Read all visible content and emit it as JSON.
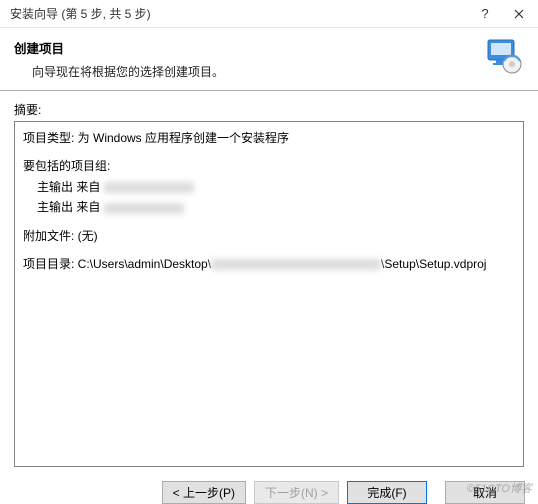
{
  "titlebar": {
    "title": "安装向导 (第 5 步, 共 5 步)"
  },
  "header": {
    "heading": "创建项目",
    "subtitle": "向导现在将根据您的选择创建项目。"
  },
  "summary": {
    "label": "摘要:",
    "project_type_line": "项目类型: 为 Windows 应用程序创建一个安装程序",
    "groups_label": "要包括的项目组:",
    "group_items": [
      "主输出 来自",
      "主输出 来自"
    ],
    "additional_files_line": "附加文件: (无)",
    "project_dir_prefix": "项目目录: C:\\Users\\admin\\Desktop\\",
    "project_dir_suffix": "\\Setup\\Setup.vdproj"
  },
  "buttons": {
    "back": "< 上一步(P)",
    "next": "下一步(N) >",
    "finish": "完成(F)",
    "cancel": "取消"
  },
  "watermark": "©51CTO博客"
}
